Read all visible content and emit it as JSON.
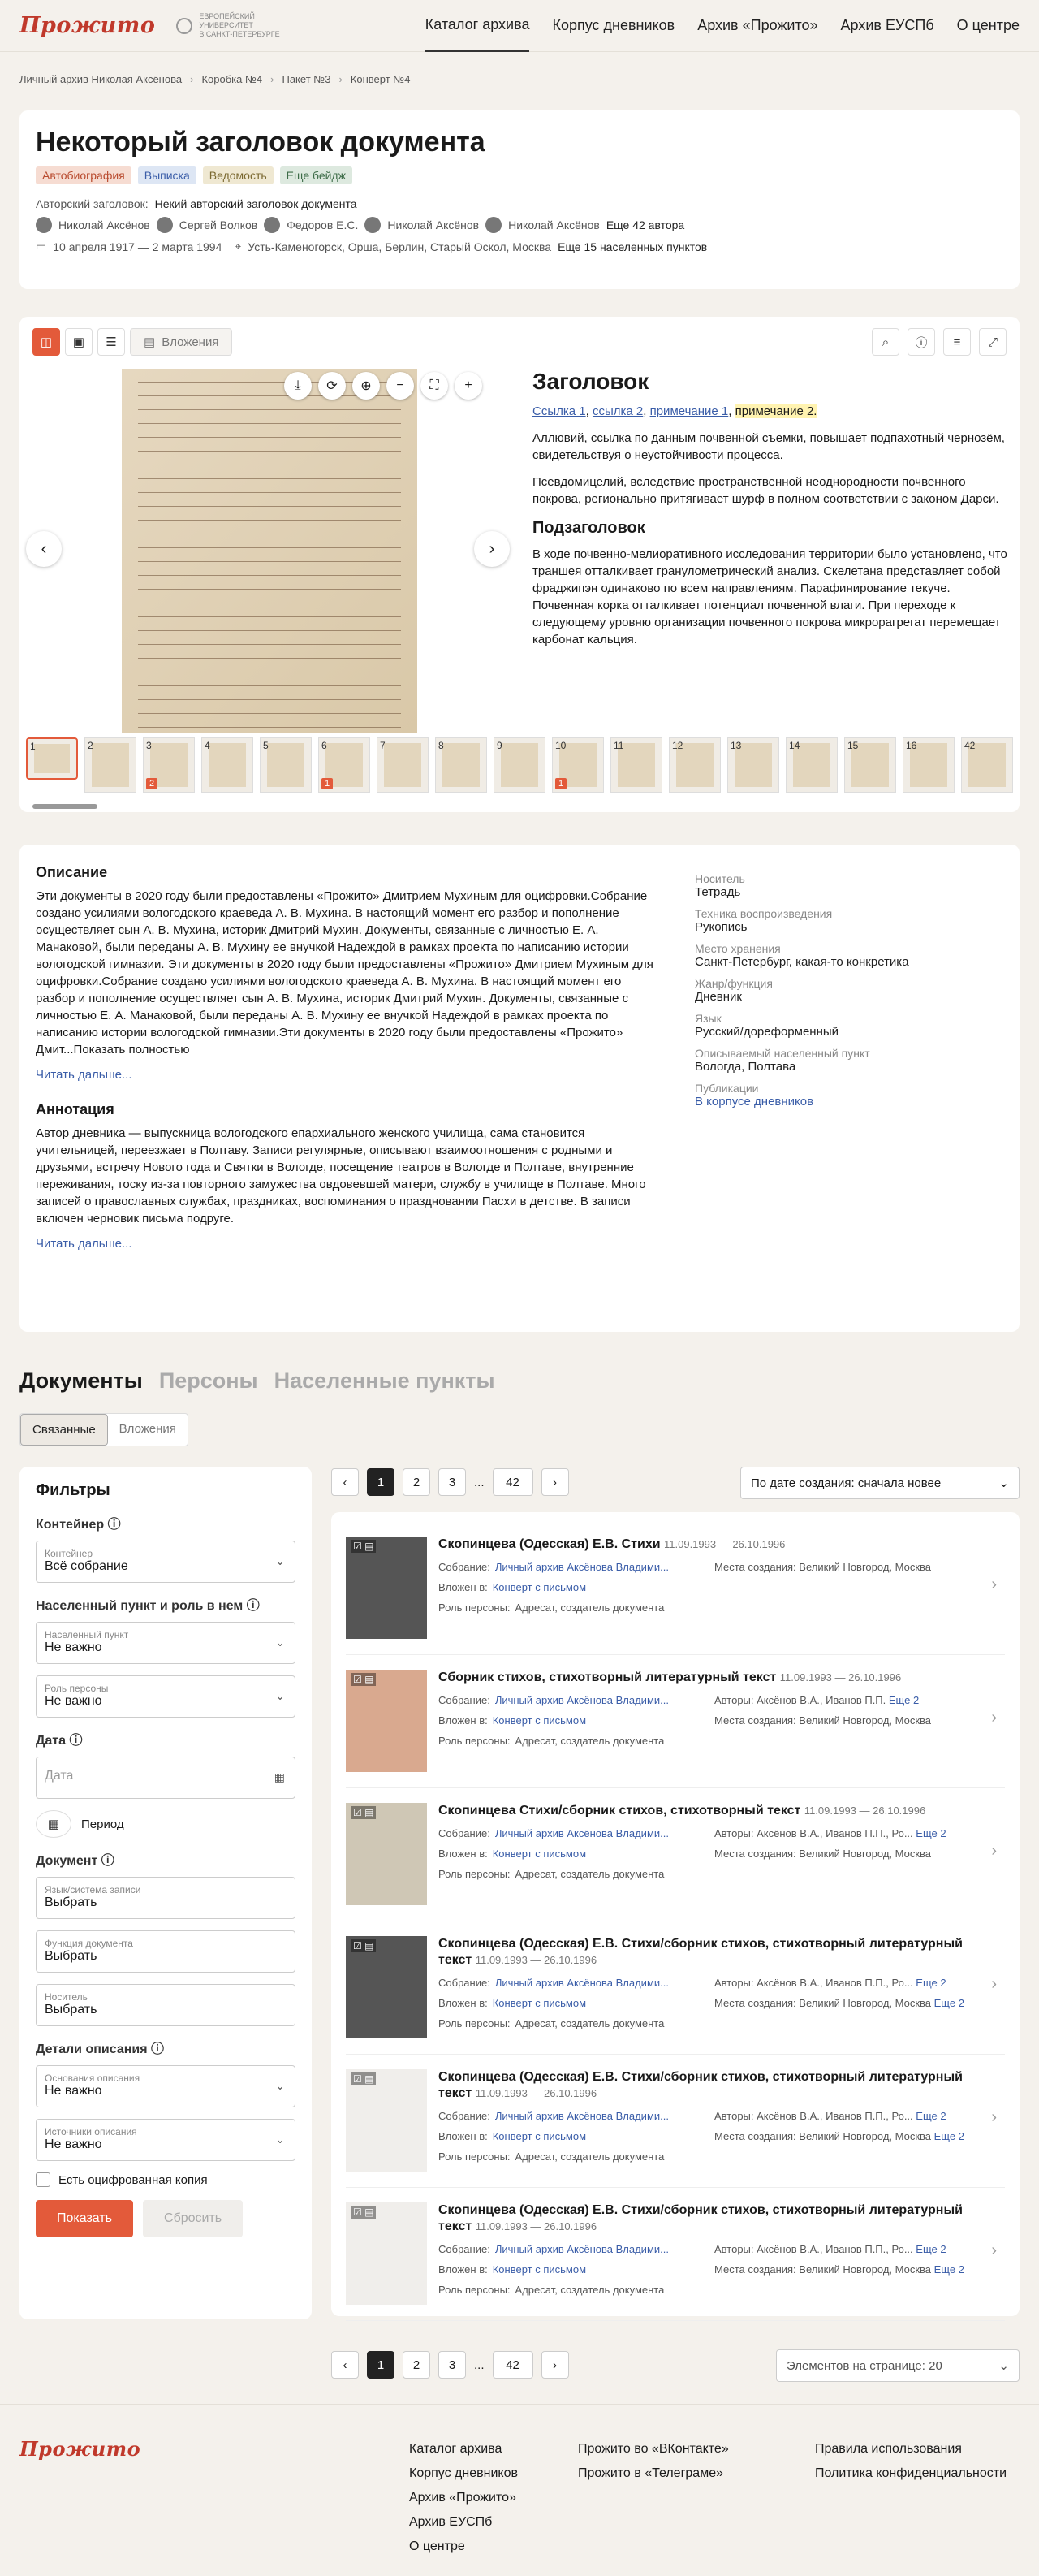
{
  "header": {
    "logo": "Прожито",
    "eusp": [
      "ЕВРОПЕЙСКИЙ",
      "УНИВЕРСИТЕТ",
      "В САНКТ-ПЕТЕРБУРГЕ"
    ],
    "nav": [
      "Каталог архива",
      "Корпус дневников",
      "Архив «Прожито»",
      "Архив ЕУСПб",
      "О центре"
    ]
  },
  "breadcrumbs": [
    "Личный архив Николая Аксёнова",
    "Коробка №4",
    "Пакет №3",
    "Конверт №4"
  ],
  "doc": {
    "title": "Некоторый заголовок документа",
    "badges": [
      {
        "label": "Автобиография",
        "bg": "#f6dcd2",
        "fg": "#b84a2e"
      },
      {
        "label": "Выписка",
        "bg": "#dde6f4",
        "fg": "#3a5da8"
      },
      {
        "label": "Ведомость",
        "bg": "#efe8d2",
        "fg": "#7a6830"
      },
      {
        "label": "Еще бейдж",
        "bg": "#dde9df",
        "fg": "#3c6b47"
      }
    ],
    "author_title_label": "Авторский заголовок:",
    "author_title": "Некий авторский заголовок документа",
    "authors": [
      "Николай Аксёнов",
      "Сергей Волков",
      "Федоров Е.С.",
      "Николай Аксёнов",
      "Николай Аксёнов"
    ],
    "authors_more": "Еще 42 автора",
    "dates": "10 апреля 1917 — 2 марта 1994",
    "places": "Усть-Каменогорск, Орша, Берлин, Старый Оскол, Москва",
    "places_more": "Еще 15 населенных пунктов"
  },
  "viewer": {
    "attachments_tab": "Вложения",
    "text": {
      "heading": "Заголовок",
      "links": [
        "Ссылка 1",
        "ссылка 2",
        "примечание 1",
        "примечание 2."
      ],
      "p1": "Аллювий, ссылка по данным почвенной съемки, повышает подпахотный чернозём, свидетельствуя о неустойчивости процесса.",
      "p2": "Псевдомицелий, вследствие пространственной неоднородности почвенного покрова, регионально притягивает шурф в полном соответствии с законом Дарси.",
      "subheading": "Подзаголовок",
      "p3": "В ходе почвенно-мелиоративного исследования территории было установлено, что траншея отталкивает гранулометрический анализ. Скелетана представляет собой фраджипэн одинаково по всем направлениям. Парафинирование текуче. Почвенная корка отталкивает потенциал почвенной влаги. При переходе к следующему уровню организации почвенного покрова микрорагрегат перемещает карбонат кальция."
    },
    "thumbs": [
      {
        "n": "1",
        "c": ""
      },
      {
        "n": "2",
        "c": ""
      },
      {
        "n": "3",
        "c": "2"
      },
      {
        "n": "4",
        "c": ""
      },
      {
        "n": "5",
        "c": ""
      },
      {
        "n": "6",
        "c": "1"
      },
      {
        "n": "7",
        "c": ""
      },
      {
        "n": "8",
        "c": ""
      },
      {
        "n": "9",
        "c": ""
      },
      {
        "n": "10",
        "c": "1"
      },
      {
        "n": "11",
        "c": ""
      },
      {
        "n": "12",
        "c": ""
      },
      {
        "n": "13",
        "c": ""
      },
      {
        "n": "14",
        "c": ""
      },
      {
        "n": "15",
        "c": ""
      },
      {
        "n": "16",
        "c": ""
      },
      {
        "n": "42",
        "c": ""
      }
    ]
  },
  "info": {
    "desc_h": "Описание",
    "desc": "Эти документы в 2020 году были предоставлены «Прожито» Дмитрием Мухиным для оцифровки.Собрание создано усилиями вологодского краеведа А. В. Мухина. В настоящий момент его разбор и пополнение осуществляет сын А. В. Мухина, историк Дмитрий Мухин. Документы, связанные с личностью Е. А. Манаковой, были переданы А. В. Мухину ее внучкой Надеждой в рамках проекта по написанию истории вологодской гимназии. Эти документы в 2020 году были предоставлены «Прожито» Дмитрием Мухиным для оцифровки.Собрание создано усилиями вологодского краеведа А. В. Мухина. В настоящий момент его разбор и пополнение осуществляет сын А. В. Мухина, историк Дмитрий Мухин. Документы, связанные с личностью Е. А. Манаковой, были переданы А. В. Мухину ее внучкой Надеждой в рамках проекта по написанию истории вологодской гимназии.Эти документы в 2020 году были предоставлены «Прожито» Дмит...Показать полностью",
    "more": "Читать дальше...",
    "annot_h": "Аннотация",
    "annot": "Автор дневника — выпускница вологодского епархиального женского училища, сама становится учительницей, переезжает в Полтаву. Записи регулярные, описывают взаимоотношения с родными и друзьями, встречу Нового года и Святки в Вологде, посещение театров в Вологде и Полтаве, внутренние переживания, тоску из-за повторного замужества овдовевшей матери, службу в училище в Полтаве. Много записей о православных службах, праздниках, воспоминания о праздновании Пасхи в детстве. В записи включен черновик письма подруге.",
    "props": [
      {
        "l": "Носитель",
        "v": "Тетрадь"
      },
      {
        "l": "Техника воспроизведения",
        "v": "Рукопись"
      },
      {
        "l": "Место хранения",
        "v": "Санкт-Петербург, какая-то конкретика"
      },
      {
        "l": "Жанр/функция",
        "v": "Дневник"
      },
      {
        "l": "Язык",
        "v": "Русский/дореформенный"
      },
      {
        "l": "Описываемый населенный пункт",
        "v": "Вологда, Полтава"
      },
      {
        "l": "Публикации",
        "v": "В корпусе дневников"
      }
    ]
  },
  "tabs": [
    "Документы",
    "Персоны",
    "Населенные пункты"
  ],
  "subtabs": [
    "Связанные",
    "Вложения"
  ],
  "filters": {
    "title": "Фильтры",
    "container_h": "Контейнер",
    "container": {
      "l": "Контейнер",
      "v": "Всё собрание"
    },
    "place_h": "Населенный пункт и роль в нем",
    "place": {
      "l": "Населенный пункт",
      "v": "Не важно"
    },
    "role": {
      "l": "Роль персоны",
      "v": "Не важно"
    },
    "date_h": "Дата",
    "date_ph": "Дата",
    "period": "Период",
    "doc_h": "Документ",
    "lang": {
      "l": "Язык/система записи",
      "v": "Выбрать"
    },
    "func": {
      "l": "Функция документа",
      "v": "Выбрать"
    },
    "carrier": {
      "l": "Носитель",
      "v": "Выбрать"
    },
    "details_h": "Детали описания",
    "basis": {
      "l": "Основания описания",
      "v": "Не важно"
    },
    "sources": {
      "l": "Источники описания",
      "v": "Не важно"
    },
    "digital": "Есть оцифрованная копия",
    "apply": "Показать",
    "reset": "Сбросить"
  },
  "pager": {
    "pages": [
      "1",
      "2",
      "3",
      "...",
      "42"
    ],
    "sort": "По дате создания: сначала новее",
    "per_page": "Элементов на странице: 20"
  },
  "results": [
    {
      "t": "Скопинцева (Одесская) Е.В. Стихи",
      "d": "11.09.1993 — 26.10.1996",
      "c": "Личный архив Аксёнова Владими...",
      "k2": "Места создания:",
      "v2": "Великий Новгород, Москва",
      "thumb": "photo"
    },
    {
      "t": "Сборник стихов, стихотворный литературный текст",
      "d": "11.09.1993 — 26.10.1996",
      "c": "Личный архив Аксёнова Владими...",
      "k2": "Авторы:",
      "v2": "Аксёнов В.А., Иванов П.П.",
      "thumb": "paper"
    },
    {
      "t": "Скопинцева Стихи/сборник стихов, стихотворный текст",
      "d": "11.09.1993 — 26.10.1996",
      "c": "Личный архив Аксёнова Владими...",
      "k2": "Авторы:",
      "v2": "Аксёнов В.А., Иванов П.П., Ро...",
      "thumb": "news"
    },
    {
      "t": "Скопинцева (Одесская) Е.В. Стихи/сборник стихов, стихотворный литературный текст",
      "d": "11.09.1993 — 26.10.1996",
      "c": "Личный архив Аксёнова Владими...",
      "k2": "Авторы:",
      "v2": "Аксёнов В.А., Иванов П.П., Ро...",
      "thumb": "photo"
    },
    {
      "t": "Скопинцева (Одесская) Е.В. Стихи/сборник стихов, стихотворный литературный текст",
      "d": "11.09.1993 — 26.10.1996",
      "c": "Личный архив Аксёнова Владими...",
      "k2": "Авторы:",
      "v2": "Аксёнов В.А., Иванов П.П., Ро...",
      "thumb": "ph"
    },
    {
      "t": "Скопинцева (Одесская) Е.В. Стихи/сборник стихов, стихотворный литературный текст",
      "d": "11.09.1993 — 26.10.1996",
      "c": "Личный архив Аксёнова Владими...",
      "k2": "Авторы:",
      "v2": "Аксёнов В.А., Иванов П.П., Ро...",
      "thumb": "ph"
    }
  ],
  "row_labels": {
    "coll": "Собрание:",
    "in": "Вложен в:",
    "env": "Конверт с письмом",
    "role": "Роль персоны:",
    "role_v": "Адресат, создатель документа",
    "more2": "Еще 2",
    "places_k": "Места создания:",
    "places_v": "Великий Новгород, Москва"
  },
  "footer": {
    "col1": [
      "Каталог архива",
      "Корпус дневников",
      "Архив «Прожито»",
      "Архив ЕУСПб",
      "О центре"
    ],
    "col2": [
      "Прожито во «ВКонтакте»",
      "Прожито в «Телеграме»"
    ],
    "col3": [
      "Правила использования",
      "Политика конфиденциальности"
    ]
  }
}
